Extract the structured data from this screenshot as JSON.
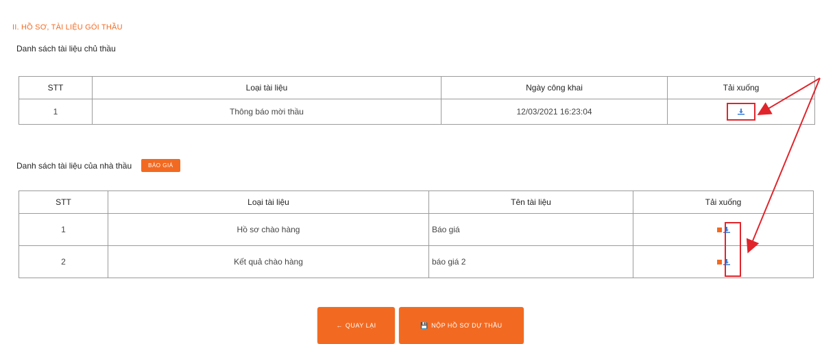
{
  "section": {
    "title": "II. HỒ SƠ, TÀI LIỆU GÓI THẦU"
  },
  "investor_docs": {
    "title": "Danh sách tài liệu chủ thầu",
    "headers": [
      "STT",
      "Loại tài liệu",
      "Ngày công khai",
      "Tải xuống"
    ],
    "rows": [
      {
        "stt": "1",
        "type": "Thông báo mời thầu",
        "date": "12/03/2021 16:23:04",
        "download_icon": "download-icon"
      }
    ]
  },
  "contractor_docs": {
    "title": "Danh sách tài liệu của nhà thầu",
    "badge": "BÁO GIÁ",
    "headers": [
      "STT",
      "Loại tài liệu",
      "Tên tài liệu",
      "Tải xuống"
    ],
    "rows": [
      {
        "stt": "1",
        "type": "Hồ sơ chào hàng",
        "name": "Báo giá",
        "download_icon": "download-icon"
      },
      {
        "stt": "2",
        "type": "Kết quả chào hàng",
        "name": "báo giá 2",
        "download_icon": "download-icon"
      }
    ]
  },
  "buttons": {
    "back": "QUAY LẠI",
    "submit": "NỘP HỒ SƠ DỰ THẦU"
  },
  "colors": {
    "accent": "#f26a21",
    "highlight": "#e0242b",
    "download": "#3a7bd5"
  }
}
